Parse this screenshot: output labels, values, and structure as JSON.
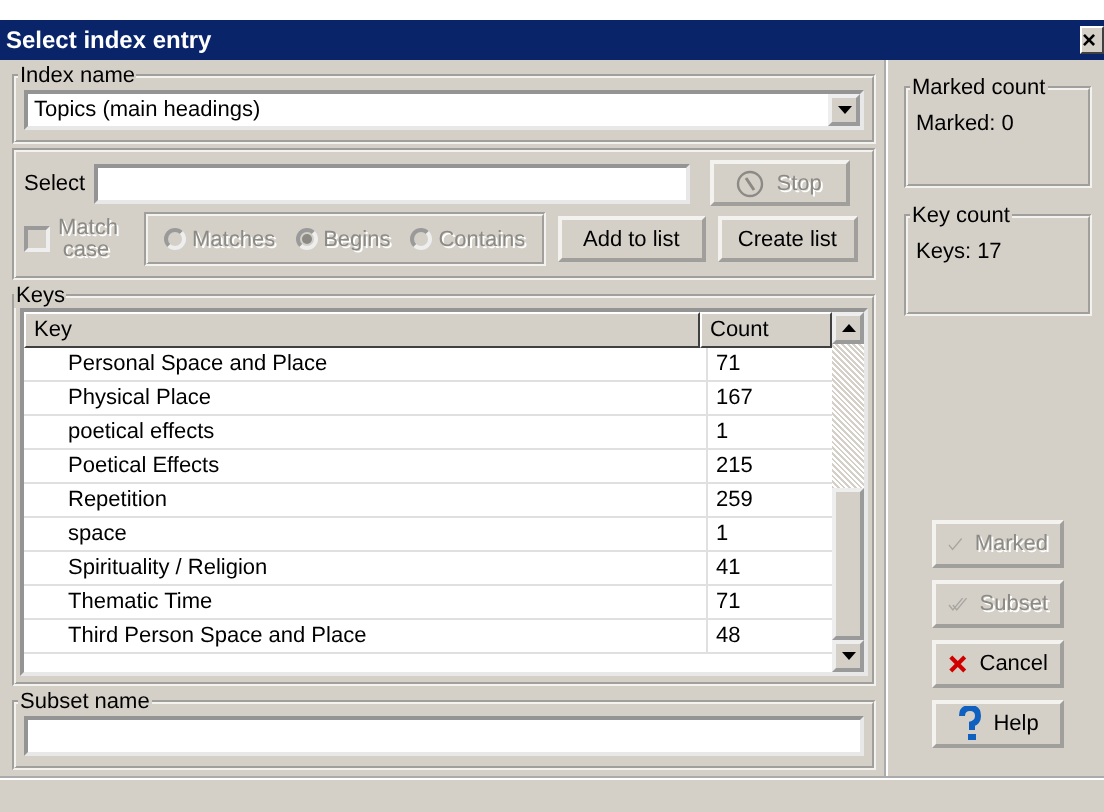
{
  "window": {
    "title": "Select index entry",
    "close": "×"
  },
  "index_name": {
    "label": "Index name",
    "value": "Topics (main headings)"
  },
  "select": {
    "label": "Select",
    "stop": {
      "label": "Stop",
      "disabled": true
    },
    "match_case": {
      "label": "Match case",
      "checked": false,
      "disabled": true
    },
    "modes": [
      {
        "label": "Matches",
        "selected": false
      },
      {
        "label": "Begins",
        "selected": true
      },
      {
        "label": "Contains",
        "selected": false
      }
    ],
    "buttons": [
      {
        "label": "Add to list"
      },
      {
        "label": "Create list"
      }
    ]
  },
  "keys": {
    "label": "Keys",
    "columns": [
      "Key",
      "Count"
    ],
    "rows": [
      {
        "key": "Personal Space and Place",
        "count": "71"
      },
      {
        "key": "Physical Place",
        "count": "167"
      },
      {
        "key": "poetical effects",
        "count": "1"
      },
      {
        "key": "Poetical Effects",
        "count": "215"
      },
      {
        "key": "Repetition",
        "count": "259"
      },
      {
        "key": "space",
        "count": "1"
      },
      {
        "key": "Spirituality / Religion",
        "count": "41"
      },
      {
        "key": "Thematic Time",
        "count": "71"
      },
      {
        "key": "Third Person Space and Place",
        "count": "48"
      }
    ]
  },
  "subset_name": {
    "label": "Subset name"
  },
  "marked_count": {
    "label": "Marked count",
    "text": "Marked: 0"
  },
  "key_count": {
    "label": "Key count",
    "text": "Keys: 17"
  },
  "actions": [
    {
      "kind": "check",
      "label": "Marked",
      "disabled": true
    },
    {
      "kind": "double-check",
      "label": "Subset",
      "disabled": true
    },
    {
      "kind": "cancel",
      "label": "Cancel",
      "disabled": false
    },
    {
      "kind": "help",
      "label": "Help",
      "disabled": false
    }
  ]
}
